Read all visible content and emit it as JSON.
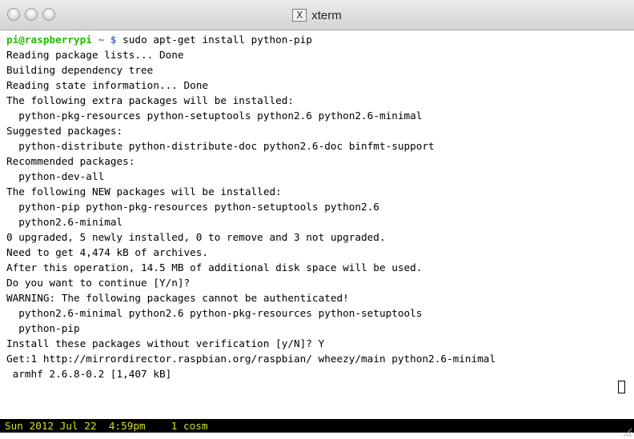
{
  "window": {
    "title": "xterm",
    "title_icon": "X"
  },
  "prompt": {
    "user_host": "pi@raspberrypi",
    "path": " ~ $ ",
    "command": "sudo apt-get install python-pip"
  },
  "output_lines": [
    "Reading package lists... Done",
    "Building dependency tree",
    "Reading state information... Done",
    "The following extra packages will be installed:",
    "  python-pkg-resources python-setuptools python2.6 python2.6-minimal",
    "Suggested packages:",
    "  python-distribute python-distribute-doc python2.6-doc binfmt-support",
    "Recommended packages:",
    "  python-dev-all",
    "The following NEW packages will be installed:",
    "  python-pip python-pkg-resources python-setuptools python2.6",
    "  python2.6-minimal",
    "0 upgraded, 5 newly installed, 0 to remove and 3 not upgraded.",
    "Need to get 4,474 kB of archives.",
    "After this operation, 14.5 MB of additional disk space will be used.",
    "Do you want to continue [Y/n]?",
    "WARNING: The following packages cannot be authenticated!",
    "  python2.6-minimal python2.6 python-pkg-resources python-setuptools",
    "  python-pip",
    "Install these packages without verification [y/N]? Y",
    "Get:1 http://mirrordirector.raspbian.org/raspbian/ wheezy/main python2.6-minimal",
    " armhf 2.6.8-0.2 [1,407 kB]"
  ],
  "status": {
    "datetime": "Sun 2012 Jul 22  4:59pm",
    "window": "1 cosm"
  }
}
